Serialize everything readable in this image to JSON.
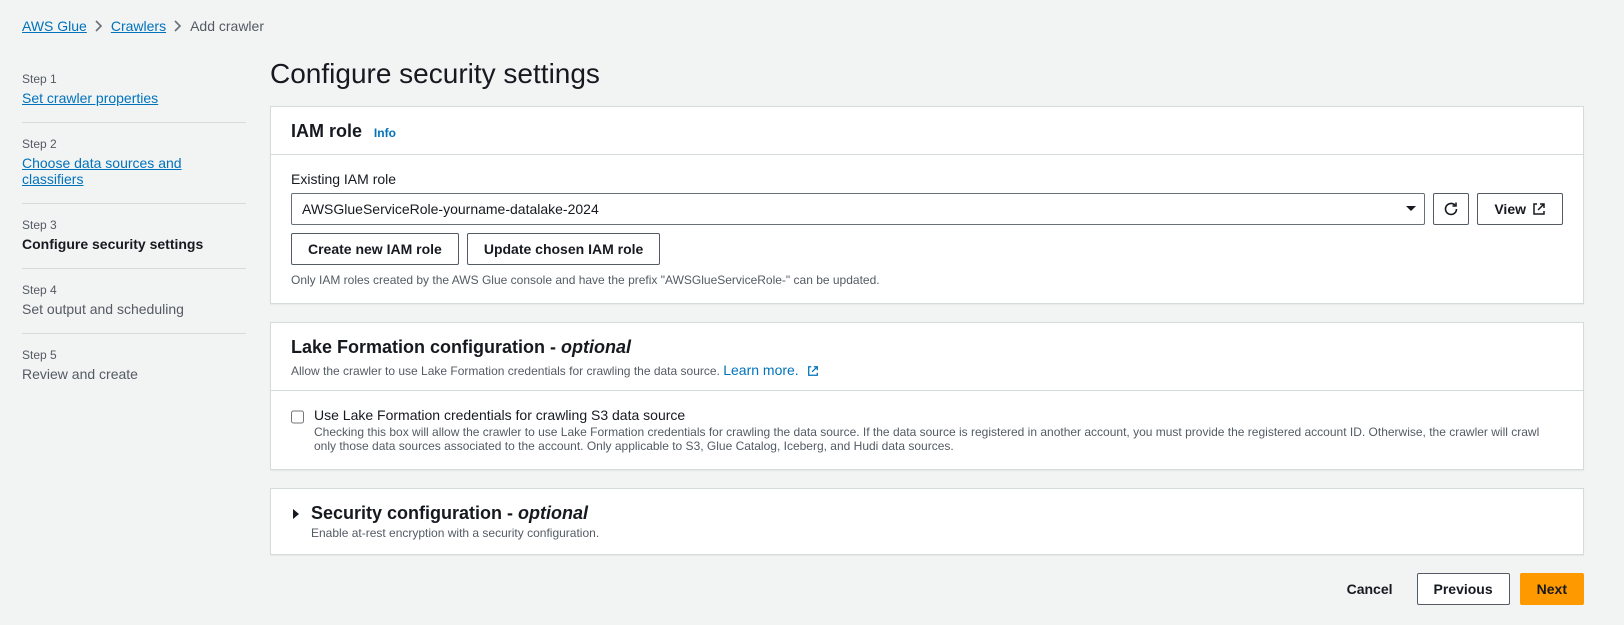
{
  "breadcrumb": {
    "item1": "AWS Glue",
    "item2": "Crawlers",
    "item3": "Add crawler"
  },
  "sidebar": {
    "steps": [
      {
        "label": "Step 1",
        "title": "Set crawler properties"
      },
      {
        "label": "Step 2",
        "title": "Choose data sources and classifiers"
      },
      {
        "label": "Step 3",
        "title": "Configure security settings"
      },
      {
        "label": "Step 4",
        "title": "Set output and scheduling"
      },
      {
        "label": "Step 5",
        "title": "Review and create"
      }
    ]
  },
  "page_title": "Configure security settings",
  "iam": {
    "heading": "IAM role",
    "info": "Info",
    "existing_label": "Existing IAM role",
    "selected_role": "AWSGlueServiceRole-yourname-datalake-2024",
    "view_btn": "View",
    "create_btn": "Create new IAM role",
    "update_btn": "Update chosen IAM role",
    "helper": "Only IAM roles created by the AWS Glue console and have the prefix \"AWSGlueServiceRole-\" can be updated."
  },
  "lakeformation": {
    "heading": "Lake Formation configuration - ",
    "optional": "optional",
    "desc": "Allow the crawler to use Lake Formation credentials for crawling the data source.",
    "learn_more": "Learn more.",
    "checkbox_label": "Use Lake Formation credentials for crawling S3 data source",
    "checkbox_desc": "Checking this box will allow the crawler to use Lake Formation credentials for crawling the data source. If the data source is registered in another account, you must provide the registered account ID. Otherwise, the crawler will crawl only those data sources associated to the account. Only applicable to S3, Glue Catalog, Iceberg, and Hudi data sources."
  },
  "security": {
    "heading": "Security configuration - ",
    "optional": "optional",
    "desc": "Enable at-rest encryption with a security configuration."
  },
  "footer": {
    "cancel": "Cancel",
    "previous": "Previous",
    "next": "Next"
  }
}
